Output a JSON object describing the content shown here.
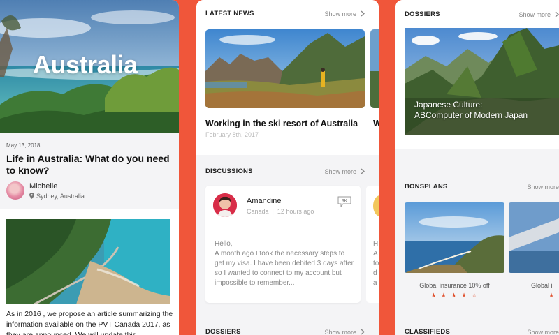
{
  "panel1": {
    "hero_title": "Australia",
    "date": "May 13, 2018",
    "headline": "Life in Australia: What do you need to know?",
    "author_name": "Michelle",
    "author_location": "Sydney, Australia",
    "body_text": "As in 2016 , we propose an article summarizing the information available on the PVT Canada 2017, as they are announced. We will update this"
  },
  "panel2": {
    "latest_news": {
      "title": "LATEST NEWS",
      "show_more": "Show more",
      "item_title": "Working in the ski resort of Australia",
      "item_date": "February 8th, 2017",
      "next_item_title_fragment": "W"
    },
    "discussions": {
      "title": "DISCUSSIONS",
      "show_more": "Show more",
      "user_name": "Amandine",
      "user_location": "Canada",
      "time_ago": "12 hours ago",
      "reply_count": "3K",
      "message": "Hello,\nA month ago I took the necessary steps to get my visa. I have been debited 3 days after so I wanted to connect to my account but impossible to remember...",
      "next_card_fragment": "H\nA\nto\nd\na"
    },
    "dossiers_bottom": {
      "title": "DOSSIERS",
      "show_more": "Show more"
    }
  },
  "panel3": {
    "dossiers": {
      "title": "DOSSIERS",
      "show_more": "Show more",
      "caption": "Japanese Culture:\nABComputer of Modern Japan"
    },
    "bonsplans": {
      "title": "BONSPLANS",
      "show_more": "Show more",
      "item_label": "Global insurance 10% off",
      "item_stars": "★ ★ ★ ★ ☆",
      "item2_label": "Global i",
      "item2_stars": "★"
    },
    "classifieds": {
      "title": "CLASSIFIEDS",
      "show_more": "Show more"
    }
  },
  "colors": {
    "background": "#f0563a",
    "star": "#e0522f"
  }
}
